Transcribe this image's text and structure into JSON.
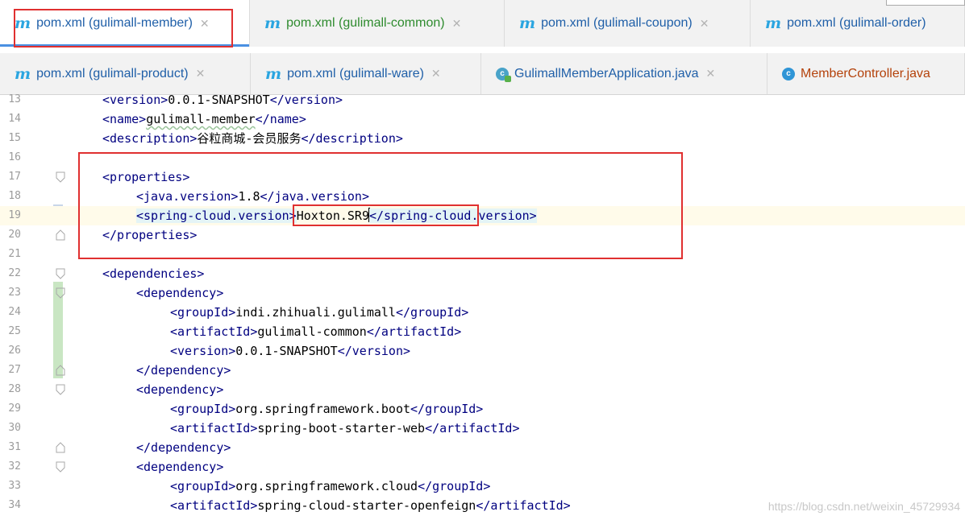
{
  "tabs_row1": [
    {
      "label": "pom.xml (gulimall-member)",
      "color": "#1f5fa8",
      "active": true,
      "width": 310
    },
    {
      "label": "pom.xml (gulimall-common)",
      "color": "#2e8b2e",
      "width": 316
    },
    {
      "label": "pom.xml (gulimall-coupon)",
      "color": "#1f5fa8",
      "width": 305
    },
    {
      "label": "pom.xml (gulimall-order)",
      "color": "#1f5fa8",
      "width": 266
    }
  ],
  "tabs_row2": [
    {
      "label": "pom.xml (gulimall-product)",
      "color": "#1f5fa8",
      "width": 311
    },
    {
      "label": "pom.xml (gulimall-ware)",
      "color": "#1f5fa8",
      "width": 286
    },
    {
      "label": "GulimallMemberApplication.java",
      "color": "#1f5fa8",
      "icon": "java-app-icon",
      "width": 355
    },
    {
      "label": "MemberController.java",
      "color": "#b4420b",
      "icon": "java-class-icon",
      "width": 245
    }
  ],
  "editor": {
    "lines": [
      {
        "n": "13",
        "indent": 1,
        "parts": [
          [
            "tag",
            "<version>"
          ],
          [
            "text",
            "0.0.1-SNAPSHOT"
          ],
          [
            "tag",
            "</version>"
          ]
        ]
      },
      {
        "n": "14",
        "indent": 1,
        "parts": [
          [
            "tag",
            "<name>"
          ],
          [
            "text",
            "gulimall-member"
          ],
          [
            "tag",
            "</name>"
          ]
        ]
      },
      {
        "n": "15",
        "indent": 1,
        "parts": [
          [
            "tag",
            "<description>"
          ],
          [
            "text",
            "谷粒商城-会员服务"
          ],
          [
            "tag",
            "</description>"
          ]
        ]
      },
      {
        "n": "16",
        "indent": 0,
        "parts": []
      },
      {
        "n": "17",
        "indent": 1,
        "parts": [
          [
            "tag",
            "<properties>"
          ]
        ]
      },
      {
        "n": "18",
        "indent": 2,
        "parts": [
          [
            "tag",
            "<java.version>"
          ],
          [
            "text",
            "1.8"
          ],
          [
            "tag",
            "</java.version>"
          ]
        ]
      },
      {
        "n": "19",
        "indent": 2,
        "parts": [
          [
            "tag",
            "<spring-cloud.version>"
          ],
          [
            "text",
            "Hoxton.SR9"
          ],
          [
            "tag",
            "</spring-cloud.version>"
          ]
        ]
      },
      {
        "n": "20",
        "indent": 1,
        "parts": [
          [
            "tag",
            "</properties>"
          ]
        ]
      },
      {
        "n": "21",
        "indent": 0,
        "parts": []
      },
      {
        "n": "22",
        "indent": 1,
        "parts": [
          [
            "tag",
            "<dependencies>"
          ]
        ]
      },
      {
        "n": "23",
        "indent": 2,
        "parts": [
          [
            "tag",
            "<dependency>"
          ]
        ]
      },
      {
        "n": "24",
        "indent": 3,
        "parts": [
          [
            "tag",
            "<groupId>"
          ],
          [
            "text",
            "indi.zhihuali.gulimall"
          ],
          [
            "tag",
            "</groupId>"
          ]
        ]
      },
      {
        "n": "25",
        "indent": 3,
        "parts": [
          [
            "tag",
            "<artifactId>"
          ],
          [
            "text",
            "gulimall-common"
          ],
          [
            "tag",
            "</artifactId>"
          ]
        ]
      },
      {
        "n": "26",
        "indent": 3,
        "parts": [
          [
            "tag",
            "<version>"
          ],
          [
            "text",
            "0.0.1-SNAPSHOT"
          ],
          [
            "tag",
            "</version>"
          ]
        ]
      },
      {
        "n": "27",
        "indent": 2,
        "parts": [
          [
            "tag",
            "</dependency>"
          ]
        ]
      },
      {
        "n": "28",
        "indent": 2,
        "parts": [
          [
            "tag",
            "<dependency>"
          ]
        ]
      },
      {
        "n": "29",
        "indent": 3,
        "parts": [
          [
            "tag",
            "<groupId>"
          ],
          [
            "text",
            "org.springframework.boot"
          ],
          [
            "tag",
            "</groupId>"
          ]
        ]
      },
      {
        "n": "30",
        "indent": 3,
        "parts": [
          [
            "tag",
            "<artifactId>"
          ],
          [
            "text",
            "spring-boot-starter-web"
          ],
          [
            "tag",
            "</artifactId>"
          ]
        ]
      },
      {
        "n": "31",
        "indent": 2,
        "parts": [
          [
            "tag",
            "</dependency>"
          ]
        ]
      },
      {
        "n": "32",
        "indent": 2,
        "parts": [
          [
            "tag",
            "<dependency>"
          ]
        ]
      },
      {
        "n": "33",
        "indent": 3,
        "parts": [
          [
            "tag",
            "<groupId>"
          ],
          [
            "text",
            "org.springframework.cloud"
          ],
          [
            "tag",
            "</groupId>"
          ]
        ]
      },
      {
        "n": "34",
        "indent": 3,
        "parts": [
          [
            "tag",
            "<artifactId>"
          ],
          [
            "text",
            "spring-cloud-starter-openfeign"
          ],
          [
            "tag",
            "</artifactId>"
          ]
        ]
      }
    ],
    "folds": {
      "17": "open",
      "20": "close",
      "22": "open",
      "23": "open",
      "27": "close",
      "28": "open",
      "31": "close",
      "32": "open"
    },
    "current_line": "19"
  },
  "watermark": "https://blog.csdn.net/weixin_45729934",
  "colors": {
    "tag": "#000080",
    "text": "#000000",
    "annotation": "#e03030",
    "tab_active_underline": "#4a90e2"
  }
}
